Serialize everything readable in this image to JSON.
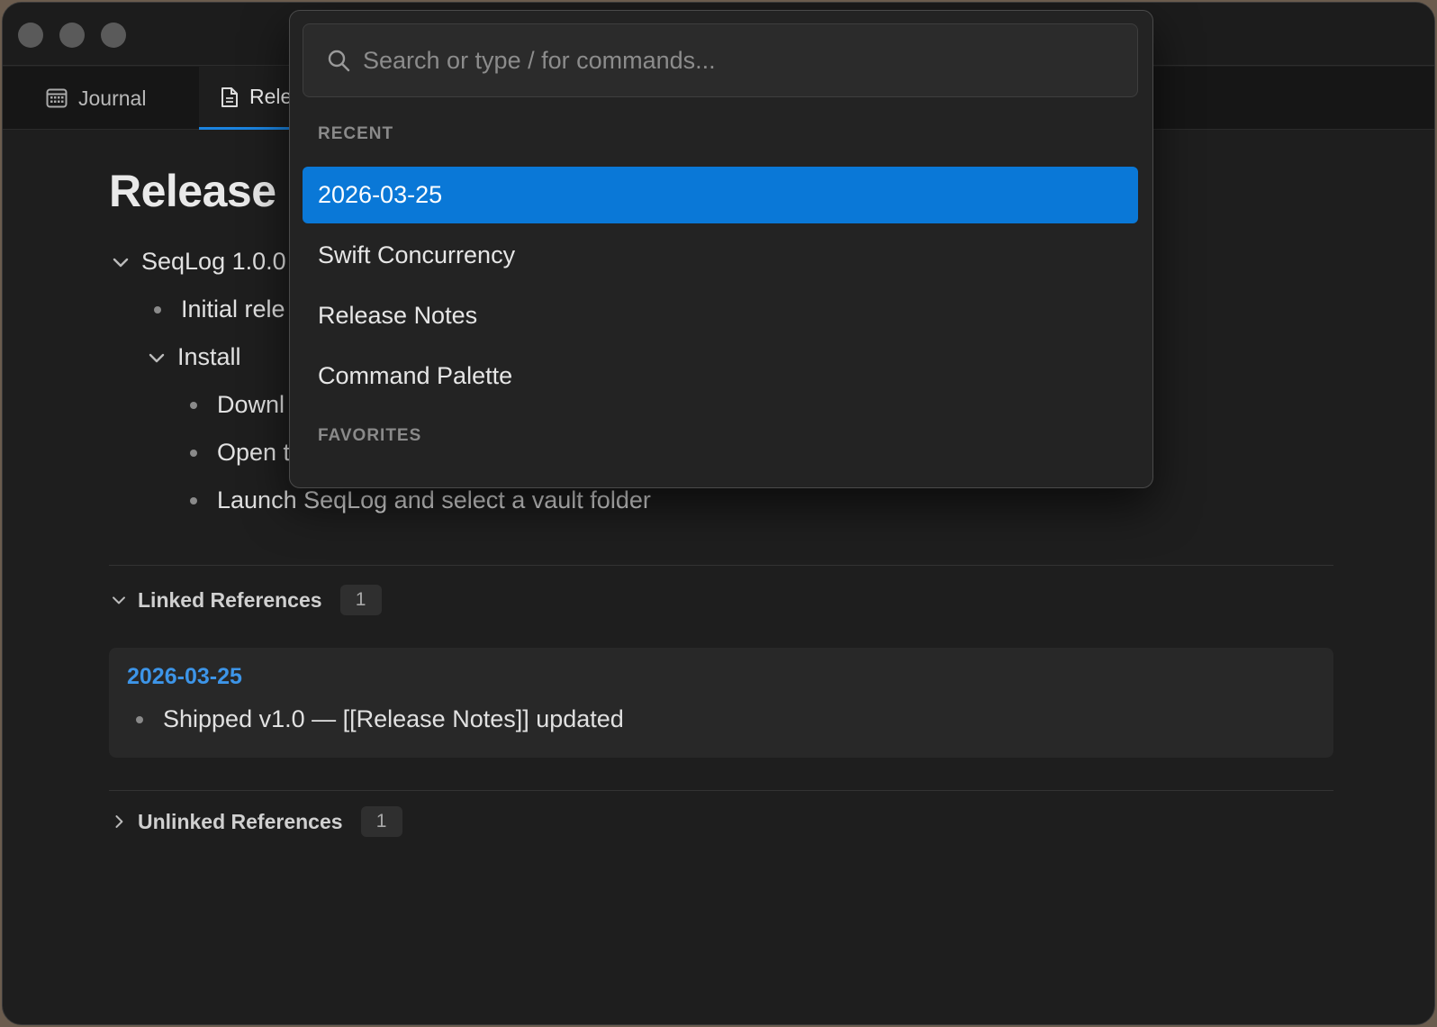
{
  "tabs": [
    {
      "label": "Journal",
      "icon": "calendar-icon"
    },
    {
      "label": "Rele",
      "icon": "document-icon"
    }
  ],
  "page": {
    "title": "Release",
    "outline": {
      "version_item": "SeqLog 1.0.0",
      "initial_item": "Initial rele",
      "install_item": "Install",
      "install_children": [
        "Downl",
        "Open t",
        "Launch SeqLog and select a vault folder"
      ]
    }
  },
  "linked_references": {
    "label": "Linked References",
    "count": "1",
    "card": {
      "date": "2026-03-25",
      "text": "Shipped v1.0 — [[Release Notes]] updated"
    }
  },
  "unlinked_references": {
    "label": "Unlinked References",
    "count": "1"
  },
  "palette": {
    "search_placeholder": "Search or type / for commands...",
    "recent_label": "RECENT",
    "recent_items": [
      "2026-03-25",
      "Swift Concurrency",
      "Release Notes",
      "Command Palette"
    ],
    "selected_index": 0,
    "favorites_label": "FAVORITES"
  },
  "colors": {
    "accent": "#0a78d7",
    "link": "#3d95e8",
    "background": "#1e1e1e"
  }
}
